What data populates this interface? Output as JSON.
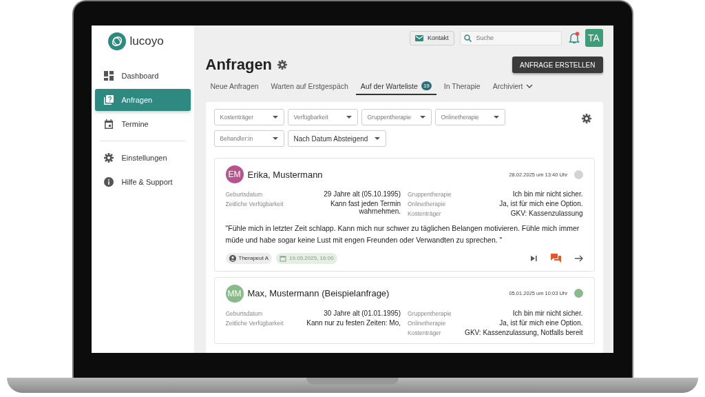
{
  "logo": {
    "text": "lucoyo"
  },
  "sidebar": {
    "groups": [
      [
        {
          "label": "Dashboard",
          "kind": "dashboard",
          "selected": false
        },
        {
          "label": "Anfragen",
          "kind": "requests",
          "selected": true
        },
        {
          "label": "Termine",
          "kind": "calendar",
          "selected": false
        }
      ],
      [
        {
          "label": "Einstellungen",
          "kind": "settings",
          "selected": false
        },
        {
          "label": "Hilfe & Support",
          "kind": "help",
          "selected": false
        }
      ]
    ]
  },
  "topbar": {
    "contact": "Kontakt",
    "search": {
      "placeholder": "Suche"
    },
    "notification": {
      "unread": true
    },
    "avatar": "TA"
  },
  "page": {
    "title": "Anfragen",
    "create_button": "ANFRAGE ERSTELLEN"
  },
  "tabs": [
    {
      "label": "Neue Anfragen",
      "selected": false
    },
    {
      "label": "Warten auf Erstgespäch",
      "selected": false
    },
    {
      "label": "Auf der Warteliste",
      "selected": true,
      "badge": "19"
    },
    {
      "label": "In Therapie",
      "selected": false
    },
    {
      "label": "Archiviert",
      "selected": false,
      "dropdown": true
    }
  ],
  "filters": [
    {
      "label": "Kostenträger",
      "kind": "placeholder"
    },
    {
      "label": "Verfügbarkeit",
      "kind": "placeholder"
    },
    {
      "label": "Gruppentherapie",
      "kind": "placeholder"
    },
    {
      "label": "Onlinetherapie",
      "kind": "placeholder"
    },
    {
      "label": "Behandler:in",
      "kind": "placeholder"
    },
    {
      "label": "Nach Datum Absteigend",
      "kind": "value"
    }
  ],
  "requests": [
    {
      "avatar": {
        "initials": "EM",
        "color": "#b5558b"
      },
      "name": "Erika, Mustermann",
      "received": "28.02.2025 um 13:40 Uhr",
      "color": "#d3d3d3",
      "left": [
        {
          "label": "Geburtsdatum",
          "value": "29 Jahre alt (05.10.1995)"
        },
        {
          "label": "Zeitliche Verfügbarkeit",
          "value": "Kann fast jeden Termin wahrnehmen."
        }
      ],
      "right": [
        {
          "label": "Gruppentherapie",
          "value": "Ich bin mir nicht sicher."
        },
        {
          "label": "Onlinetherapie",
          "value": "Ja, ist für mich eine Option."
        },
        {
          "label": "Kostenträger",
          "value": "GKV: Kassenzulassung"
        }
      ],
      "message": "\"Fühle mich in letzter Zeit schlapp. Kann mich nur schwer zu täglichen Belangen motivieren. Fühle mich immer müde und habe sogar keine Lust mit engen Freunden oder Verwandten zu sprechen. \"",
      "therapist": "Therapeut A",
      "appointment": "19.05.2025, 16:00",
      "unread_messages": true
    },
    {
      "avatar": {
        "initials": "MM",
        "color": "#8aba8c"
      },
      "name": "Max, Mustermann (Beispielanfrage)",
      "received": "05.01.2025 um 10:03 Uhr",
      "color": "#8aba8c",
      "left": [
        {
          "label": "Geburtsdatum",
          "value": "30 Jahre alt (01.01.1995)"
        },
        {
          "label": "Zeitliche Verfügbarkeit",
          "value": "Kann nur zu festen Zeiten: Mo,"
        }
      ],
      "right": [
        {
          "label": "Gruppentherapie",
          "value": "Ich bin mir nicht sicher."
        },
        {
          "label": "Onlinetherapie",
          "value": "Ja, ist für mich eine Option."
        },
        {
          "label": "Kostenträger",
          "value": "GKV: Kassenzulassung, Notfalls bereit"
        }
      ]
    }
  ]
}
